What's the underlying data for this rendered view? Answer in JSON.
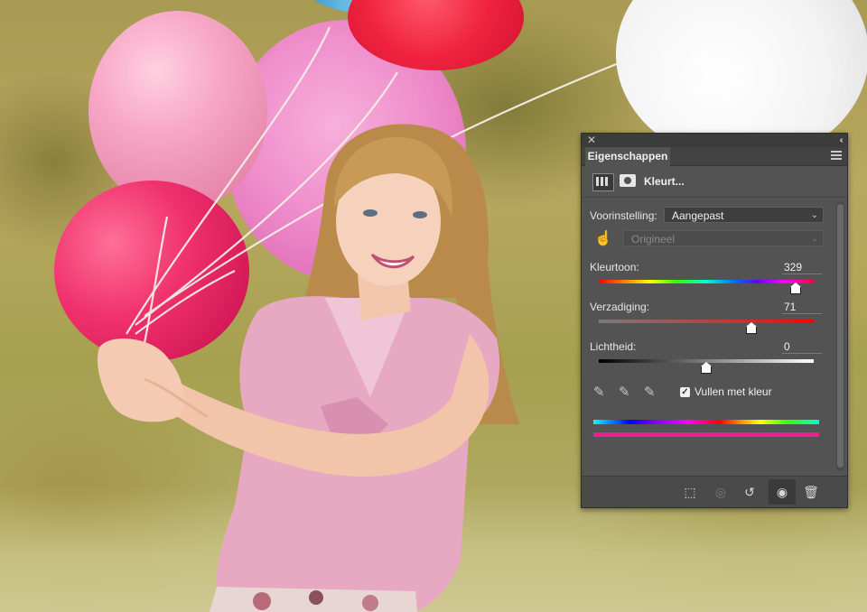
{
  "panel": {
    "tab_label": "Eigenschappen",
    "adjustment_title": "Kleurt...",
    "preset": {
      "label": "Voorinstelling:",
      "value": "Aangepast"
    },
    "channel": {
      "value": "Origineel"
    },
    "hue": {
      "label": "Kleurtoon:",
      "value": "329",
      "position_fraction": 0.914
    },
    "saturation": {
      "label": "Verzadiging:",
      "value": "71",
      "position_fraction": 0.71
    },
    "lightness": {
      "label": "Lichtheid:",
      "value": "0",
      "position_fraction": 0.5
    },
    "colorize": {
      "label": "Vullen met kleur",
      "checked": true
    },
    "footer_buttons": [
      "clip-to-layer-icon",
      "view-previous-state-icon",
      "reset-icon",
      "visibility-eye-icon",
      "trash-icon"
    ]
  },
  "colors": {
    "panel_bg": "#535353",
    "colorize_result": "#ee1f8a"
  }
}
